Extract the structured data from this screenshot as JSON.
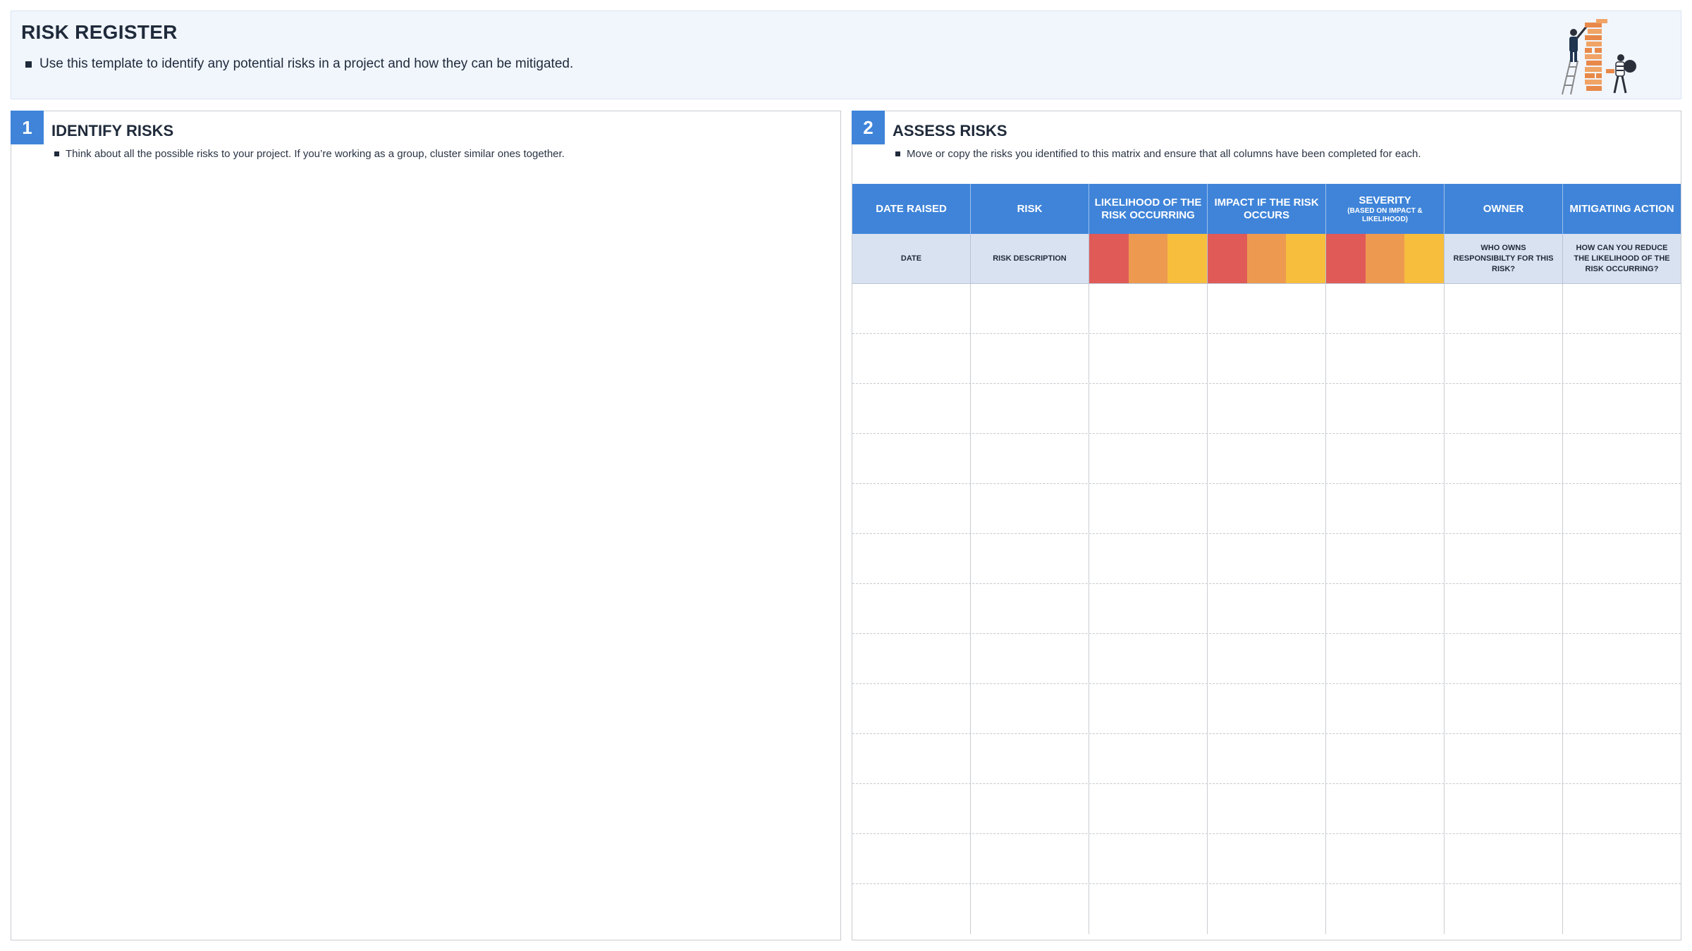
{
  "header": {
    "title": "RISK REGISTER",
    "description": "Use this template to identify any potential risks in a project and how they can be mitigated."
  },
  "colors": {
    "accent": "#3f84d9",
    "banner_bg": "#f1f6fd",
    "subheader_bg": "#d9e2f1",
    "risk_high": "#e05a57",
    "risk_medium": "#ed9a50",
    "risk_low": "#f7bd3c"
  },
  "identify": {
    "number": "1",
    "title": "IDENTIFY RISKS",
    "description": "Think about all the possible risks to your project. If you’re working as a group, cluster similar ones together."
  },
  "assess": {
    "number": "2",
    "title": "ASSESS RISKS",
    "description": "Move or copy the risks you identified to this matrix and ensure that all columns have been completed for each.",
    "columns": [
      {
        "label": "DATE RAISED",
        "sub": "",
        "hint": "DATE"
      },
      {
        "label": "RISK",
        "sub": "",
        "hint": "RISK DESCRIPTION"
      },
      {
        "label": "LIKELIHOOD OF THE RISK OCCURRING",
        "sub": "",
        "hint": ""
      },
      {
        "label": "IMPACT IF THE RISK OCCURS",
        "sub": "",
        "hint": ""
      },
      {
        "label": "SEVERITY",
        "sub": "(BASED ON IMPACT & LIKELIHOOD)",
        "hint": ""
      },
      {
        "label": "OWNER",
        "sub": "",
        "hint": "WHO OWNS RESPONSIBILTY FOR THIS RISK?"
      },
      {
        "label": "MITIGATING ACTION",
        "sub": "",
        "hint": "HOW CAN YOU REDUCE THE LIKELIHOOD OF THE RISK OCCURRING?"
      }
    ],
    "empty_rows": 13
  }
}
